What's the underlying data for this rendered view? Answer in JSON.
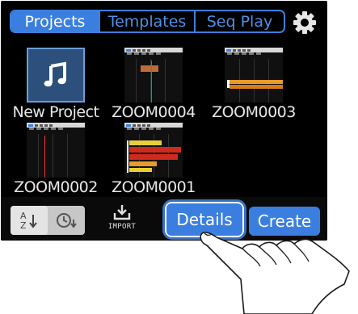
{
  "tabs": [
    {
      "label": "Projects",
      "active": true
    },
    {
      "label": "Templates",
      "active": false
    },
    {
      "label": "Seq Play",
      "active": false
    }
  ],
  "projects": [
    {
      "name": "New Project",
      "kind": "new",
      "icon": "music-note-icon"
    },
    {
      "name": "ZOOM0004",
      "kind": "project"
    },
    {
      "name": "ZOOM0003",
      "kind": "project"
    },
    {
      "name": "ZOOM0002",
      "kind": "project"
    },
    {
      "name": "ZOOM0001",
      "kind": "project"
    }
  ],
  "toolbar": {
    "import_label": "IMPORT",
    "details_label": "Details",
    "create_label": "Create"
  },
  "colors": {
    "accent": "#3a7fe0",
    "screen_bg": "#000000",
    "new_project_bg": "#2c4f7c"
  }
}
